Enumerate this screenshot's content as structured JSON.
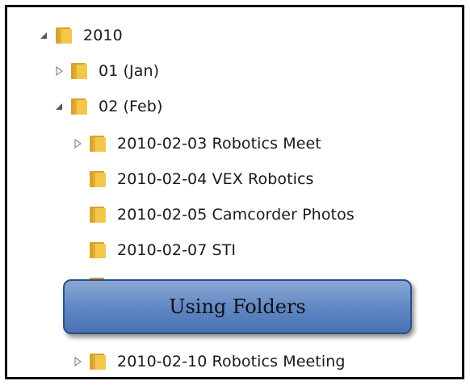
{
  "tree": {
    "items": [
      {
        "label": "2010",
        "state": "expanded"
      },
      {
        "label": "01 (Jan)",
        "state": "collapsed"
      },
      {
        "label": "02 (Feb)",
        "state": "expanded"
      },
      {
        "label": "2010-02-03 Robotics Meet",
        "state": "collapsed"
      },
      {
        "label": "2010-02-04 VEX Robotics",
        "state": "none"
      },
      {
        "label": "2010-02-05 Camcorder Photos",
        "state": "none"
      },
      {
        "label": "2010-02-07 STI",
        "state": "none"
      },
      {
        "label": "2010-02-10 Robotics Meeting",
        "state": "collapsed"
      }
    ]
  },
  "callout": {
    "text": "Using Folders"
  },
  "colors": {
    "folder_front": "#f3c84a",
    "folder_back": "#d9a22c",
    "callout_fill": "#6a8fcb",
    "frame_border": "#000000"
  },
  "icons": {
    "folder": "folder-icon",
    "expanded": "expanded-triangle-icon",
    "collapsed": "collapsed-triangle-icon"
  }
}
